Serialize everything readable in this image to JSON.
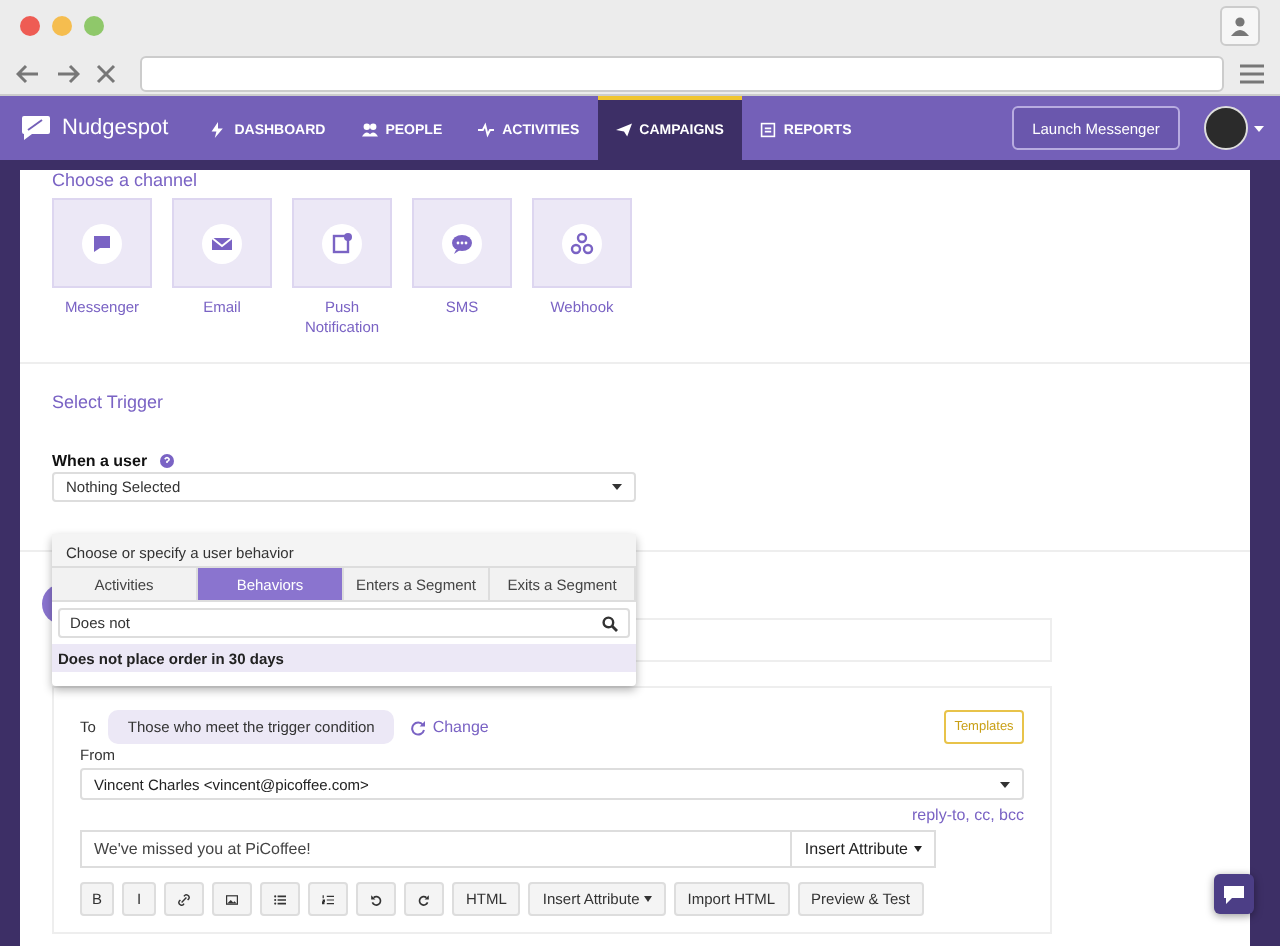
{
  "nav": {
    "brand": "Nudgespot",
    "items": [
      {
        "kind": "dashboard",
        "label": "DASHBOARD",
        "selected": false
      },
      {
        "kind": "people",
        "label": "PEOPLE",
        "selected": false
      },
      {
        "kind": "activities",
        "label": "ACTIVITIES",
        "selected": false
      },
      {
        "kind": "campaigns",
        "label": "CAMPAIGNS",
        "selected": true
      },
      {
        "kind": "reports",
        "label": "REPORTS",
        "selected": false
      }
    ],
    "launch_button": "Launch Messenger"
  },
  "channels": {
    "title": "Choose a channel",
    "items": [
      {
        "kind": "messenger",
        "label": "Messenger"
      },
      {
        "kind": "email",
        "label": "Email"
      },
      {
        "kind": "push",
        "label": "Push Notification"
      },
      {
        "kind": "sms",
        "label": "SMS"
      },
      {
        "kind": "webhook",
        "label": "Webhook"
      }
    ]
  },
  "trigger": {
    "title": "Select Trigger",
    "label": "When a user",
    "select": "Nothing Selected",
    "dropdown": {
      "header": "Choose or specify a user behavior",
      "tabs": [
        {
          "label": "Activities",
          "selected": false
        },
        {
          "label": "Behaviors",
          "selected": true
        },
        {
          "label": "Enters a Segment",
          "selected": false
        },
        {
          "label": "Exits a Segment",
          "selected": false
        }
      ],
      "search": {
        "value": "Does not"
      },
      "results": [
        {
          "label": "Does not place order in 30 days",
          "selected": true
        }
      ]
    }
  },
  "message": {
    "to_label": "To",
    "to_value": "Those who meet the trigger condition",
    "change_link": "Change",
    "templates_button": "Templates",
    "from_label": "From",
    "from_value": "Vincent Charles <vincent@picoffee.com>",
    "reply_link": "reply-to, cc, bcc",
    "subject": "We've missed you at PiCoffee!",
    "insert_attribute": "Insert Attribute",
    "toolbar": [
      {
        "kind": "bold",
        "label": "B"
      },
      {
        "kind": "italic",
        "label": "I"
      },
      {
        "kind": "link"
      },
      {
        "kind": "image"
      },
      {
        "kind": "bullets"
      },
      {
        "kind": "numbers"
      },
      {
        "kind": "undo"
      },
      {
        "kind": "redo"
      },
      {
        "kind": "text",
        "label": "HTML"
      },
      {
        "kind": "dropdown",
        "label": "Insert Attribute"
      },
      {
        "kind": "text",
        "label": "Import HTML"
      },
      {
        "kind": "text",
        "label": "Preview & Test"
      }
    ]
  }
}
